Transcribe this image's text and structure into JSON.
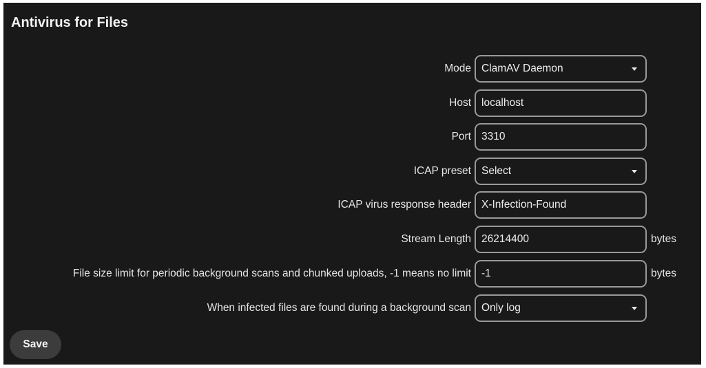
{
  "section": {
    "title": "Antivirus for Files"
  },
  "form": {
    "mode": {
      "label": "Mode",
      "value": "ClamAV Daemon"
    },
    "host": {
      "label": "Host",
      "value": "localhost"
    },
    "port": {
      "label": "Port",
      "value": "3310"
    },
    "icap_preset": {
      "label": "ICAP preset",
      "value": "Select"
    },
    "icap_header": {
      "label": "ICAP virus response header",
      "value": "X-Infection-Found"
    },
    "stream_length": {
      "label": "Stream Length",
      "value": "26214400",
      "unit": "bytes"
    },
    "file_size_limit": {
      "label": "File size limit for periodic background scans and chunked uploads, -1 means no limit",
      "value": "-1",
      "unit": "bytes"
    },
    "infected_action": {
      "label": "When infected files are found during a background scan",
      "value": "Only log"
    }
  },
  "actions": {
    "save_label": "Save"
  },
  "icons": {
    "dropdown": "chevron-down-icon"
  },
  "colors": {
    "background": "#191919",
    "field_border": "#9a9a9a",
    "button_bg": "#3c3c3c",
    "text": "#ededed"
  }
}
